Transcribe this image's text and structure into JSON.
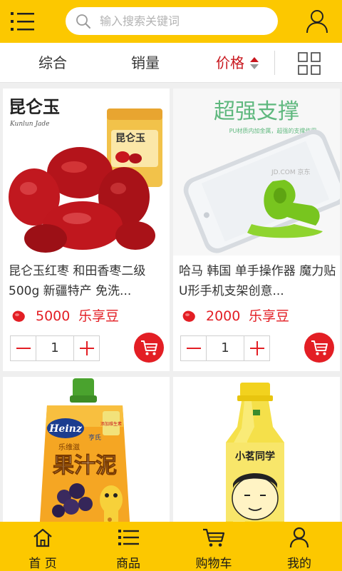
{
  "search": {
    "placeholder": "输入搜索关键词"
  },
  "sort": {
    "tabs": [
      {
        "label": "综合"
      },
      {
        "label": "销量"
      },
      {
        "label": "价格"
      }
    ],
    "active_color": "#c8161d"
  },
  "theme": {
    "primary": "#fcc800",
    "price": "#e31e24"
  },
  "products": [
    {
      "title": "昆仑玉红枣 和田香枣二级500g 新疆特产 免洗...",
      "price": "5000",
      "unit": "乐享豆",
      "qty": "1",
      "image_text": {
        "brand": "昆仑玉",
        "brand_sub": "Kunlun Jade",
        "pack_brand": "昆仑玉"
      }
    },
    {
      "title": "哈马 韩国 单手操作器 魔力贴 U形手机支架创意...",
      "price": "2000",
      "unit": "乐享豆",
      "qty": "1",
      "image_text": {
        "headline": "超强支撑",
        "subline": "PU材质内加金属，超强的支撑作用",
        "watermark": "JD.COM 京东"
      }
    },
    {
      "title": "",
      "price": "",
      "unit": "",
      "qty": "",
      "image_text": {
        "brand": "Heinz",
        "brand_cn": "亨氏",
        "series": "乐维滋",
        "product": "果汁泥",
        "badge": "添加维生素"
      }
    },
    {
      "title": "",
      "price": "",
      "unit": "",
      "qty": "",
      "image_text": {
        "label": "小茗同学"
      }
    }
  ],
  "bottom_nav": [
    {
      "label": "首 页",
      "icon": "home-icon"
    },
    {
      "label": "商品",
      "icon": "list-icon"
    },
    {
      "label": "购物车",
      "icon": "cart-icon"
    },
    {
      "label": "我的",
      "icon": "user-icon"
    }
  ]
}
